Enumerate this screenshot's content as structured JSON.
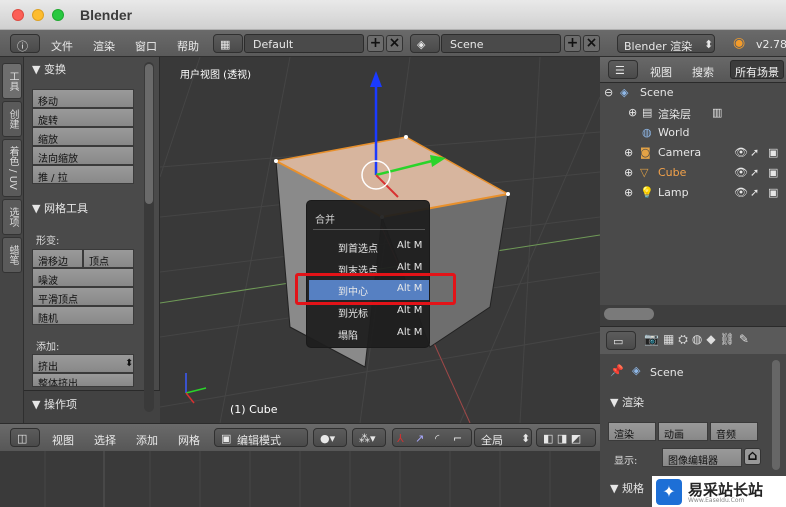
{
  "window": {
    "title": "Blender"
  },
  "topbar": {
    "menus": [
      "文件",
      "渲染",
      "窗口",
      "帮助"
    ],
    "layout": "Default",
    "scene": "Scene",
    "engine": "Blender 渲染",
    "version": "v2.78"
  },
  "tabs": [
    "工具",
    "创建",
    "着色 / UV",
    "选项",
    "蜡笔"
  ],
  "toolshelf": {
    "transform_header": "▼ 变换",
    "transform_buttons": [
      "移动",
      "旋转",
      "缩放",
      "法向缩放",
      "推 / 拉"
    ],
    "mesh_header": "▼ 网格工具",
    "deform_label": "形变:",
    "slide_edge": "滑移边",
    "vertex": "顶点",
    "noise": "噪波",
    "smooth_vertex": "平滑顶点",
    "random": "随机",
    "add_label": "添加:",
    "extrude": "挤出",
    "extrude_region": "整体挤出",
    "operator_header": "▼ 操作项"
  },
  "viewport": {
    "label": "用户视图 (透视)",
    "object_label": "(1) Cube"
  },
  "popup": {
    "title": "合并",
    "items": [
      {
        "label": "到首选点",
        "shortcut": "Alt M"
      },
      {
        "label": "到末选点",
        "shortcut": "Alt M"
      },
      {
        "label": "到中心",
        "shortcut": "Alt M"
      },
      {
        "label": "到光标",
        "shortcut": "Alt M"
      },
      {
        "label": "塌陷",
        "shortcut": "Alt M"
      }
    ],
    "selected_index": 2
  },
  "vp_header": {
    "menus": [
      "视图",
      "选择",
      "添加",
      "网格"
    ],
    "mode": "编辑模式",
    "pivot": "全局"
  },
  "outliner": {
    "menus": [
      "视图",
      "搜索"
    ],
    "filter": "所有场景",
    "rows": [
      "Scene",
      "渲染层",
      "World",
      "Camera",
      "Cube",
      "Lamp"
    ]
  },
  "properties": {
    "scene": "Scene",
    "render_header": "▼ 渲染",
    "render_btn": "渲染",
    "anim_btn": "动画",
    "audio_btn": "音频",
    "display_label": "显示:",
    "display_value": "图像编辑器",
    "dims_header": "▼ 规格"
  },
  "watermark": {
    "name": "易采站长站",
    "sub": "Www.EaseIdu.Com"
  },
  "colors": {
    "selection": "#5680c2",
    "highlight": "#e31318",
    "cube_face": "#d7b59e"
  }
}
